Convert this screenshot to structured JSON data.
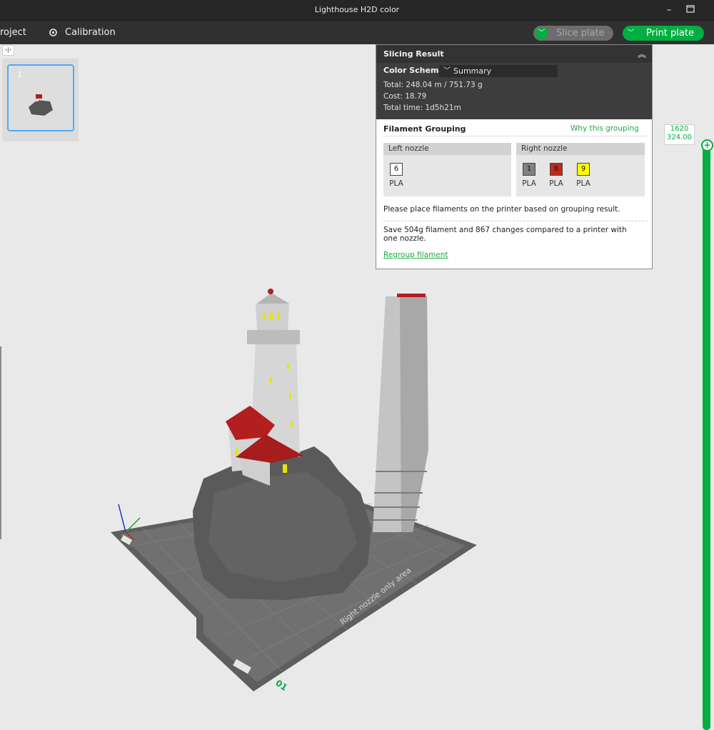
{
  "window": {
    "title": "Lighthouse H2D color",
    "minimize_icon": "minimize-icon",
    "maximize_icon": "maximize-icon"
  },
  "toolbar": {
    "project_label": "roject",
    "calibration_label": "Calibration",
    "slice_label": "Slice plate",
    "print_label": "Print plate"
  },
  "plates": {
    "thumb_number": "1"
  },
  "slicing_result": {
    "title": "Slicing Result",
    "color_scheme_label": "Color Scheme",
    "color_scheme_value": "Summary",
    "total": "Total:  248.04 m / 751.73 g",
    "cost": "Cost:  18.79",
    "total_time": "Total time:  1d5h21m"
  },
  "filament_grouping": {
    "title": "Filament Grouping",
    "why_link": "Why this grouping",
    "left_nozzle": {
      "label": "Left nozzle",
      "slots": [
        {
          "id": "6",
          "material": "PLA",
          "color": "#ffffff"
        }
      ]
    },
    "right_nozzle": {
      "label": "Right nozzle",
      "slots": [
        {
          "id": "1",
          "material": "PLA",
          "color": "#808080"
        },
        {
          "id": "8",
          "material": "PLA",
          "color": "#c0281e"
        },
        {
          "id": "9",
          "material": "PLA",
          "color": "#ffff00"
        }
      ]
    },
    "place_text": "Please place filaments on the printer based on grouping result.",
    "save_text": "Save 504g filament and 867 changes compared to a printer with one nozzle.",
    "regroup_link": "Regroup filament"
  },
  "layer_slider": {
    "layer": "1620",
    "height": "324.00"
  },
  "plate": {
    "label": "Right nozzle only area",
    "plate_number": "01"
  },
  "colors": {
    "accent": "#00ae42",
    "selection": "#51a8f5"
  }
}
